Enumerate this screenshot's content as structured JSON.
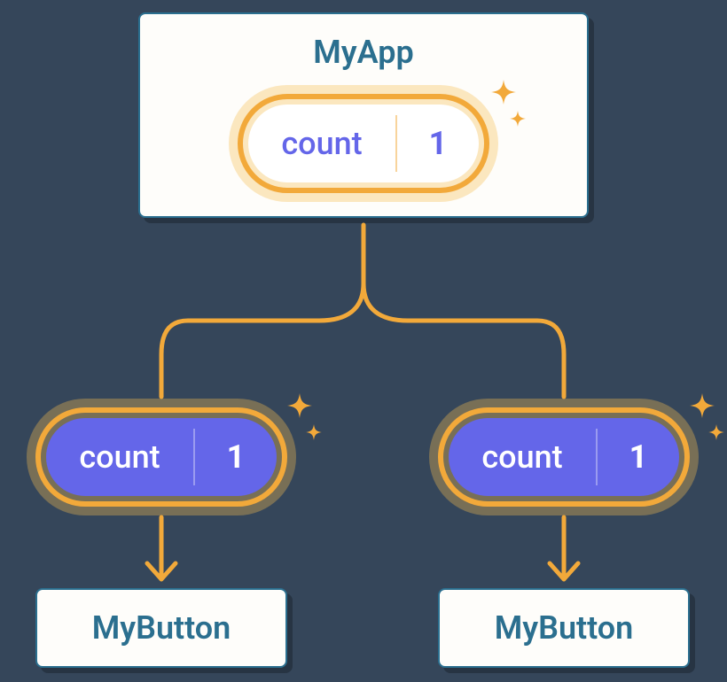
{
  "root": {
    "title": "MyApp"
  },
  "state": {
    "label": "count",
    "value": "1"
  },
  "props": [
    {
      "label": "count",
      "value": "1"
    },
    {
      "label": "count",
      "value": "1"
    }
  ],
  "children": [
    {
      "label": "MyButton"
    },
    {
      "label": "MyButton"
    }
  ],
  "colors": {
    "accent_orange": "#f2a93a",
    "accent_purple": "#6466e9",
    "box_border": "#2b6f8f",
    "background": "#35465a"
  }
}
